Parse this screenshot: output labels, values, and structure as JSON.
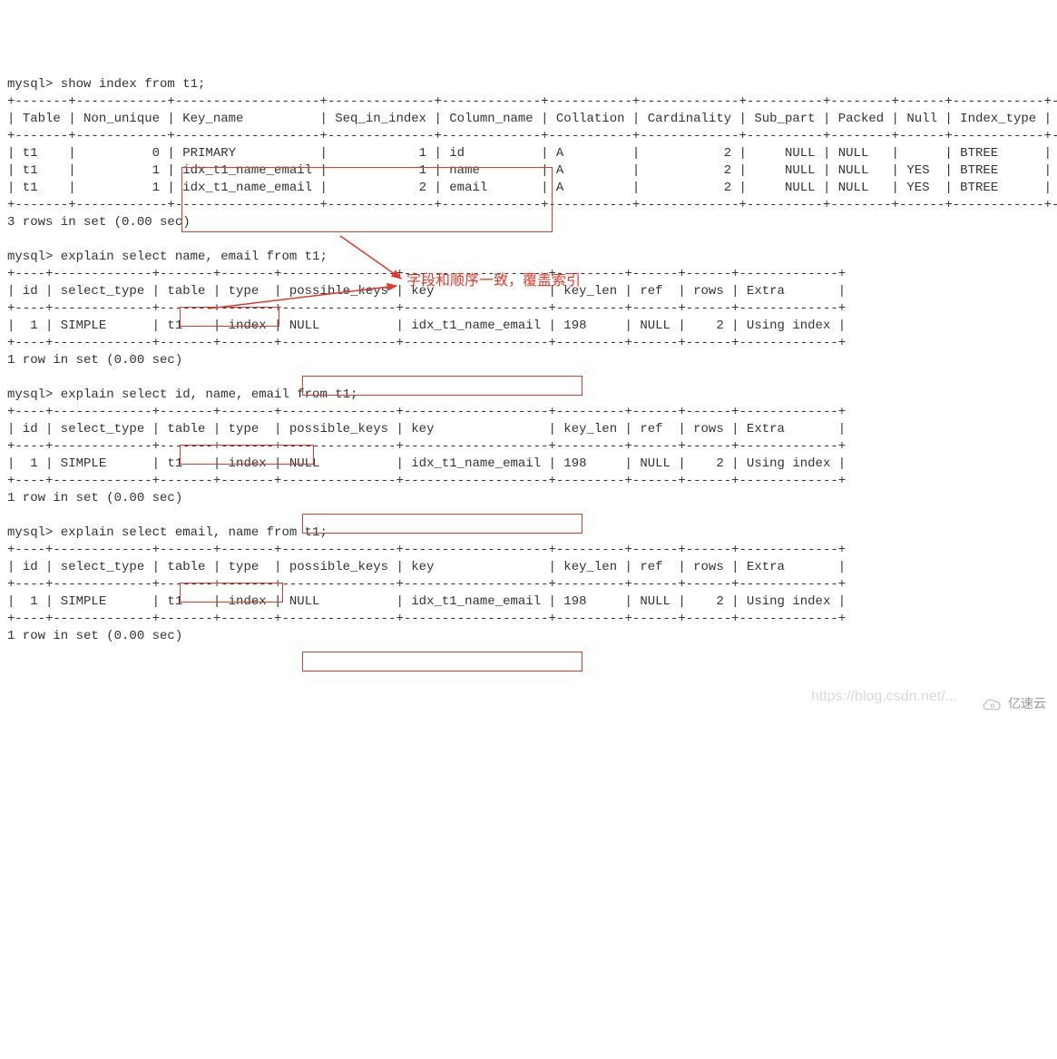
{
  "prompt": "mysql>",
  "cmd_show_index": "show index from t1;",
  "border_index_top": "+-------+------------+-------------------+--------------+-------------+-----------+-------------+----------+--------+------+------------+---------+---------------+",
  "header_index": "| Table | Non_unique | Key_name          | Seq_in_index | Column_name | Collation | Cardinality | Sub_part | Packed | Null | Index_type | Comment | Index_comment |",
  "row_index_1": "| t1    |          0 | PRIMARY           |            1 | id          | A         |           2 |     NULL | NULL   |      | BTREE      |         |               |",
  "row_index_2": "| t1    |          1 | idx_t1_name_email |            1 | name        | A         |           2 |     NULL | NULL   | YES  | BTREE      |         |               |",
  "row_index_3": "| t1    |          1 | idx_t1_name_email |            2 | email       | A         |           2 |     NULL | NULL   | YES  | BTREE      |         |               |",
  "rows_msg_3": "3 rows in set (0.00 sec)",
  "rows_msg_1": "1 row in set (0.00 sec)",
  "cmd_explain1": "explain select name, email from t1;",
  "cmd_explain2": "explain select id, name, email from t1;",
  "cmd_explain3": "explain select email, name from t1;",
  "border_explain": "+----+-------------+-------+-------+---------------+-------------------+---------+------+------+-------------+",
  "header_explain": "| id | select_type | table | type  | possible_keys | key               | key_len | ref  | rows | Extra       |",
  "row_explain": "|  1 | SIMPLE      | t1    | index | NULL          | idx_t1_name_email | 198     | NULL |    2 | Using index |",
  "annotation_text": "字段和顺序一致，覆盖索引",
  "watermark_text": "https://blog.csdn.net/...",
  "logo_text": "亿速云"
}
